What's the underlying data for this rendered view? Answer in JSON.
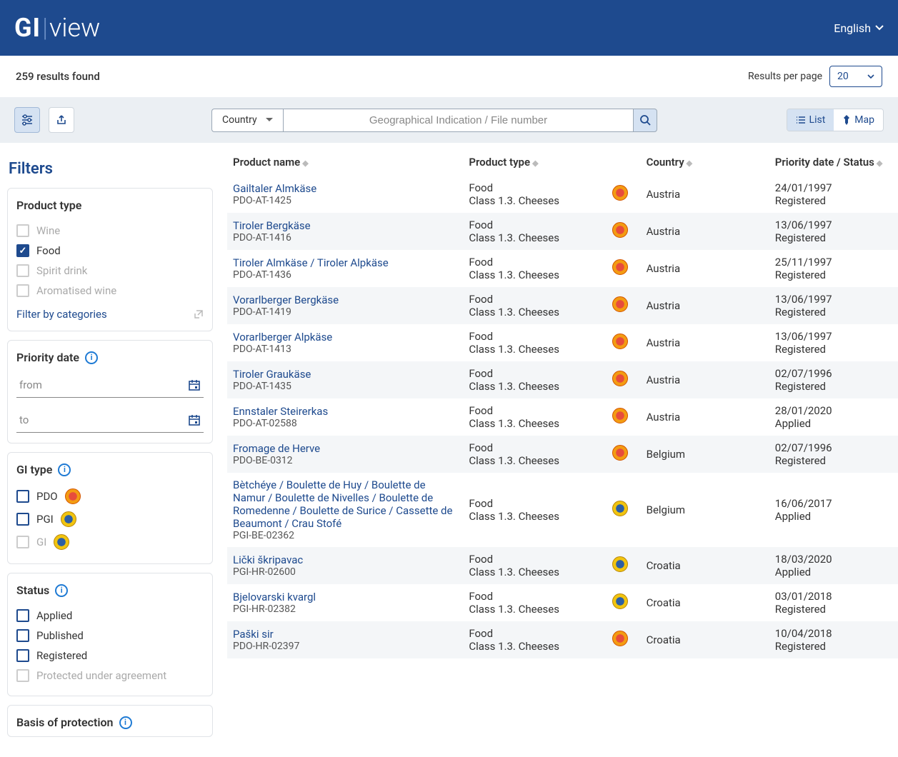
{
  "header": {
    "logo_gi": "GI",
    "logo_view": "view",
    "language": "English"
  },
  "results_bar": {
    "count_text": "259 results found",
    "per_page_label": "Results per page",
    "per_page_value": "20"
  },
  "toolbar": {
    "search_scope": "Country",
    "search_placeholder": "Geographical Indication / File number",
    "list_label": "List",
    "map_label": "Map"
  },
  "filters": {
    "title": "Filters",
    "product_type": {
      "heading": "Product type",
      "wine": "Wine",
      "food": "Food",
      "spirit": "Spirit drink",
      "aromatised": "Aromatised wine",
      "by_categories": "Filter by categories"
    },
    "priority_date": {
      "heading": "Priority date",
      "from": "from",
      "to": "to"
    },
    "gi_type": {
      "heading": "GI type",
      "pdo": "PDO",
      "pgi": "PGI",
      "gi": "GI"
    },
    "status": {
      "heading": "Status",
      "applied": "Applied",
      "published": "Published",
      "registered": "Registered",
      "protected": "Protected under agreement"
    },
    "basis": {
      "heading": "Basis of protection"
    }
  },
  "table": {
    "headers": {
      "product_name": "Product name",
      "product_type": "Product type",
      "country": "Country",
      "priority": "Priority date / Status"
    },
    "rows": [
      {
        "name": "Gailtaler Almkäse",
        "code": "PDO-AT-1425",
        "type": "Food",
        "class": "Class 1.3. Cheeses",
        "badge": "pdo",
        "country": "Austria",
        "date": "24/01/1997",
        "status": "Registered"
      },
      {
        "name": "Tiroler Bergkäse",
        "code": "PDO-AT-1416",
        "type": "Food",
        "class": "Class 1.3. Cheeses",
        "badge": "pdo",
        "country": "Austria",
        "date": "13/06/1997",
        "status": "Registered"
      },
      {
        "name": "Tiroler Almkäse / Tiroler Alpkäse",
        "code": "PDO-AT-1436",
        "type": "Food",
        "class": "Class 1.3. Cheeses",
        "badge": "pdo",
        "country": "Austria",
        "date": "25/11/1997",
        "status": "Registered"
      },
      {
        "name": "Vorarlberger Bergkäse",
        "code": "PDO-AT-1419",
        "type": "Food",
        "class": "Class 1.3. Cheeses",
        "badge": "pdo",
        "country": "Austria",
        "date": "13/06/1997",
        "status": "Registered"
      },
      {
        "name": "Vorarlberger Alpkäse",
        "code": "PDO-AT-1413",
        "type": "Food",
        "class": "Class 1.3. Cheeses",
        "badge": "pdo",
        "country": "Austria",
        "date": "13/06/1997",
        "status": "Registered"
      },
      {
        "name": "Tiroler Graukäse",
        "code": "PDO-AT-1435",
        "type": "Food",
        "class": "Class 1.3. Cheeses",
        "badge": "pdo",
        "country": "Austria",
        "date": "02/07/1996",
        "status": "Registered"
      },
      {
        "name": "Ennstaler Steirerkas",
        "code": "PDO-AT-02588",
        "type": "Food",
        "class": "Class 1.3. Cheeses",
        "badge": "pdo",
        "country": "Austria",
        "date": "28/01/2020",
        "status": "Applied"
      },
      {
        "name": "Fromage de Herve",
        "code": "PDO-BE-0312",
        "type": "Food",
        "class": "Class 1.3. Cheeses",
        "badge": "pdo",
        "country": "Belgium",
        "date": "02/07/1996",
        "status": "Registered"
      },
      {
        "name": "Bètchéye / Boulette de Huy / Boulette de Namur / Boulette de Nivelles / Boulette de Romedenne / Boulette de Surice / Cassette de Beaumont / Crau Stofé",
        "code": "PGI-BE-02362",
        "type": "Food",
        "class": "Class 1.3. Cheeses",
        "badge": "pgi",
        "country": "Belgium",
        "date": "16/06/2017",
        "status": "Applied"
      },
      {
        "name": "Lički škripavac",
        "code": "PGI-HR-02600",
        "type": "Food",
        "class": "Class 1.3. Cheeses",
        "badge": "pgi",
        "country": "Croatia",
        "date": "18/03/2020",
        "status": "Applied"
      },
      {
        "name": "Bjelovarski kvargl",
        "code": "PGI-HR-02382",
        "type": "Food",
        "class": "Class 1.3. Cheeses",
        "badge": "pgi",
        "country": "Croatia",
        "date": "03/01/2018",
        "status": "Registered"
      },
      {
        "name": "Paški sir",
        "code": "PDO-HR-02397",
        "type": "Food",
        "class": "Class 1.3. Cheeses",
        "badge": "pdo",
        "country": "Croatia",
        "date": "10/04/2018",
        "status": "Registered"
      }
    ]
  }
}
